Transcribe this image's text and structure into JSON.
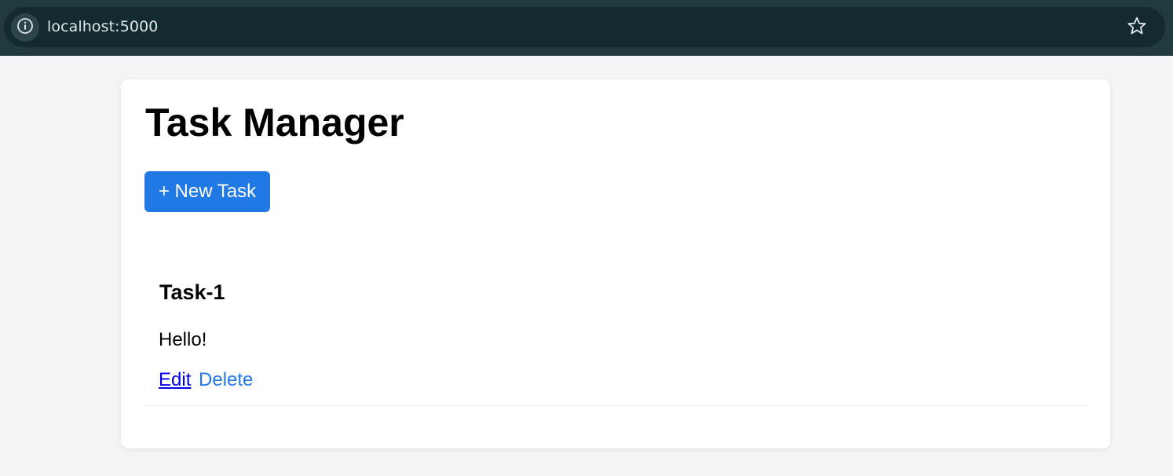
{
  "browser": {
    "url": "localhost:5000",
    "icons": {
      "site_info": "info-circle-icon",
      "bookmark": "star-outline-icon"
    }
  },
  "page": {
    "title": "Task Manager",
    "new_task_label": "+ New Task"
  },
  "tasks": [
    {
      "title": "Task-1",
      "description": "Hello!",
      "edit_label": "Edit",
      "delete_label": "Delete"
    }
  ],
  "colors": {
    "primary": "#2079e5",
    "link": "#0000ee",
    "background": "#f3f4f6",
    "browser_chrome": "#203a40"
  }
}
